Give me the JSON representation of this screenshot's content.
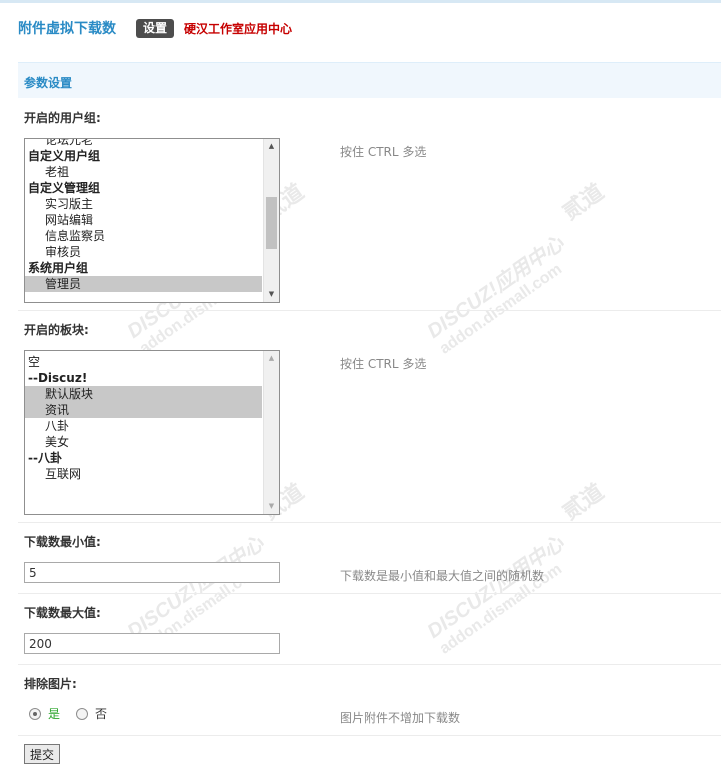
{
  "header": {
    "title": "附件虚拟下载数",
    "tab_settings": "设置",
    "vendor_link": "硬汉工作室应用中心"
  },
  "section": {
    "title": "参数设置"
  },
  "usergroups": {
    "label": "开启的用户组:",
    "hint": "按住 CTRL 多选",
    "options": [
      {
        "text": "论坛元老",
        "type": "opt",
        "selected": false
      },
      {
        "text": "自定义用户组",
        "type": "group",
        "selected": false
      },
      {
        "text": "老祖",
        "type": "opt",
        "selected": false
      },
      {
        "text": "自定义管理组",
        "type": "group",
        "selected": false
      },
      {
        "text": "实习版主",
        "type": "opt",
        "selected": false
      },
      {
        "text": "网站编辑",
        "type": "opt",
        "selected": false
      },
      {
        "text": "信息监察员",
        "type": "opt",
        "selected": false
      },
      {
        "text": "审核员",
        "type": "opt",
        "selected": false
      },
      {
        "text": "系统用户组",
        "type": "group",
        "selected": false
      },
      {
        "text": "管理员",
        "type": "opt",
        "selected": true
      }
    ]
  },
  "forums": {
    "label": "开启的板块:",
    "hint": "按住 CTRL 多选",
    "options": [
      {
        "text": "空",
        "type": "plain",
        "selected": false
      },
      {
        "text": "--Discuz!",
        "type": "group",
        "selected": false
      },
      {
        "text": "默认版块",
        "type": "opt",
        "selected": true
      },
      {
        "text": "资讯",
        "type": "opt",
        "selected": true
      },
      {
        "text": "八卦",
        "type": "opt",
        "selected": false
      },
      {
        "text": "美女",
        "type": "opt",
        "selected": false
      },
      {
        "text": "--八卦",
        "type": "group",
        "selected": false
      },
      {
        "text": "互联网",
        "type": "opt",
        "selected": false
      }
    ]
  },
  "min_downloads": {
    "label": "下载数最小值:",
    "value": "5",
    "hint": "下载数是最小值和最大值之间的随机数"
  },
  "max_downloads": {
    "label": "下载数最大值:",
    "value": "200"
  },
  "exclude_images": {
    "label": "排除图片:",
    "yes": "是",
    "no": "否",
    "selected": "yes",
    "hint": "图片附件不增加下载数"
  },
  "submit_label": "提交",
  "watermark": {
    "brand": "DISCUZ!应用中心",
    "domain": "addon.dismall.com",
    "mark": "贰道"
  }
}
